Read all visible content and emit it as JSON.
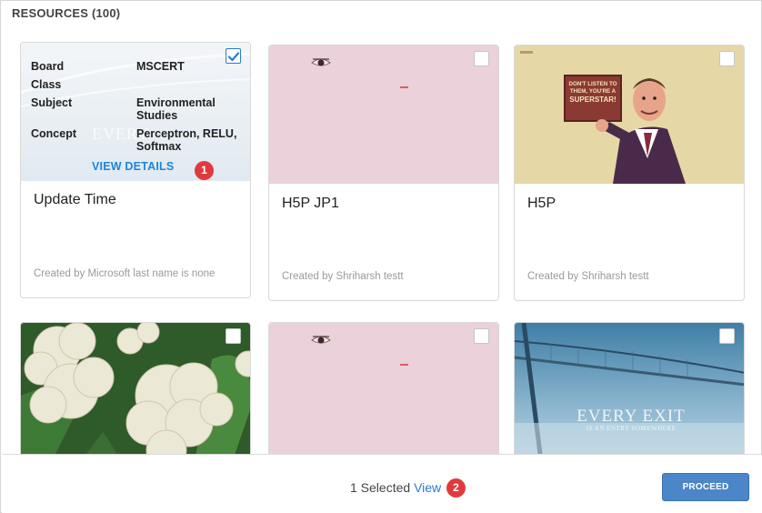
{
  "header": {
    "title": "RESOURCES (100)"
  },
  "cards": [
    {
      "title": "Update Time",
      "created": "Created by Microsoft last name is none",
      "checked": true,
      "details": [
        {
          "key": "Board",
          "value": "MSCERT"
        },
        {
          "key": "Class",
          "value": ""
        },
        {
          "key": "Subject",
          "value": "Environmental Studies"
        },
        {
          "key": "Concept",
          "value": "Perceptron, RELU, Softmax"
        }
      ],
      "view_details": "VIEW DETAILS",
      "badge": "1",
      "watermark": "EVERY"
    },
    {
      "title": "H5P JP1",
      "created": "Created by Shriharsh testt",
      "checked": false
    },
    {
      "title": "H5P",
      "created": "Created by Shriharsh testt",
      "checked": false,
      "sign_lines": [
        "DON'T LISTEN TO",
        "THEM, YOU'RE A",
        "SUPERSTAR!"
      ]
    },
    {
      "checked": false
    },
    {
      "checked": false
    },
    {
      "checked": false,
      "bridge_text": "EVERY EXIT",
      "bridge_subtext": "IS AN ENTRY SOMEWHERE"
    }
  ],
  "footer": {
    "selected_text": "1 Selected",
    "view_label": "View",
    "badge": "2",
    "proceed_label": "PROCEED"
  },
  "colors": {
    "accent": "#2a7ad6",
    "proceed_bg": "#4a86c8",
    "badge": "#e03a3e",
    "pink_thumb": "#ead1da"
  }
}
